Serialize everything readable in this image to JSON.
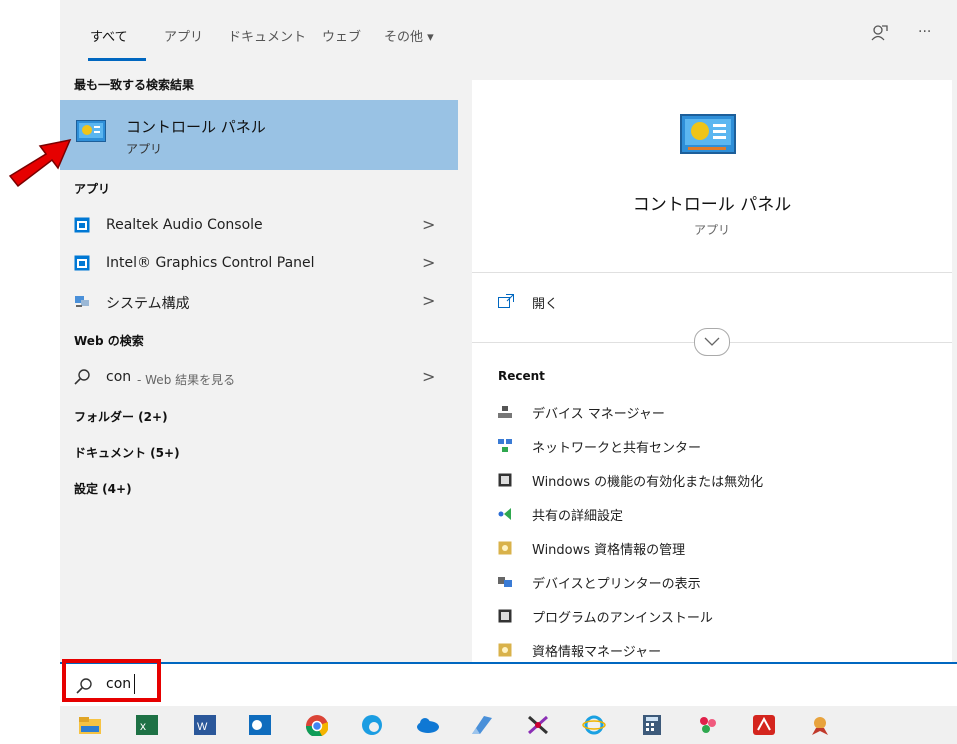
{
  "tabs": [
    "すべて",
    "アプリ",
    "ドキュメント",
    "ウェブ",
    "その他 ▾"
  ],
  "header_icons": {
    "feedback": "feedback-icon",
    "more": "···"
  },
  "left": {
    "best_match_heading": "最も一致する検索結果",
    "best_match": {
      "title": "コントロール パネル",
      "subtitle": "アプリ"
    },
    "apps_heading": "アプリ",
    "apps": [
      {
        "label": "Realtek Audio Console"
      },
      {
        "label": "Intel® Graphics Control Panel"
      },
      {
        "label": "システム構成"
      }
    ],
    "web_heading": "Web の検索",
    "web_result": {
      "query": "con",
      "suffix": " - Web 結果を見る"
    },
    "folders": "フォルダー (2+)",
    "documents": "ドキュメント (5+)",
    "settings": "設定 (4+)",
    "chevron": ">"
  },
  "right": {
    "title": "コントロール パネル",
    "subtitle": "アプリ",
    "open_label": "開く",
    "recent_heading": "Recent",
    "recent": [
      "デバイス マネージャー",
      "ネットワークと共有センター",
      "Windows の機能の有効化または無効化",
      "共有の詳細設定",
      "Windows 資格情報の管理",
      "デバイスとプリンターの表示",
      "プログラムのアンインストール",
      "資格情報マネージャー"
    ]
  },
  "search": {
    "value": "con"
  },
  "taskbar": [
    "file-explorer",
    "excel",
    "word",
    "outlook",
    "chrome",
    "edge",
    "onedrive",
    "app-blue",
    "snipping-tool",
    "internet-explorer",
    "calculator",
    "pinwheel-app",
    "acrobat",
    "paint-tool"
  ]
}
